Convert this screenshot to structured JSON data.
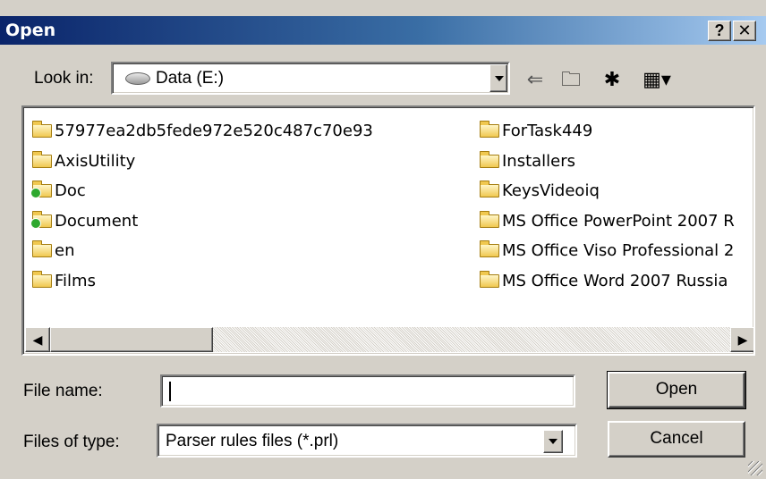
{
  "window": {
    "title": "Open",
    "help_label": "?",
    "close_label": "✕"
  },
  "lookin": {
    "label": "Look in:",
    "value": "Data (E:)"
  },
  "toolbar": {
    "back": "⇐",
    "up_folder": "🗀",
    "new_folder": "✱",
    "views": "▦▾"
  },
  "files": {
    "col1": [
      {
        "name": "57977ea2db5fede972e520c487c70e93",
        "shared": false
      },
      {
        "name": "AxisUtility",
        "shared": false
      },
      {
        "name": "Doc",
        "shared": true
      },
      {
        "name": "Document",
        "shared": true
      },
      {
        "name": "en",
        "shared": false
      },
      {
        "name": "Films",
        "shared": false
      }
    ],
    "col2": [
      {
        "name": "ForTask449",
        "shared": false
      },
      {
        "name": "Installers",
        "shared": false
      },
      {
        "name": "KeysVideoiq",
        "shared": false
      },
      {
        "name": "MS Office PowerPoint 2007 R",
        "shared": false
      },
      {
        "name": "MS Office Viso Professional 2",
        "shared": false
      },
      {
        "name": "MS Office Word 2007 Russia",
        "shared": false
      }
    ]
  },
  "scroll": {
    "left_arrow": "◀",
    "right_arrow": "▶"
  },
  "filename": {
    "label": "File name:",
    "value": ""
  },
  "filetype": {
    "label": "Files of type:",
    "value": "Parser rules files (*.prl)"
  },
  "buttons": {
    "open": "Open",
    "cancel": "Cancel"
  }
}
